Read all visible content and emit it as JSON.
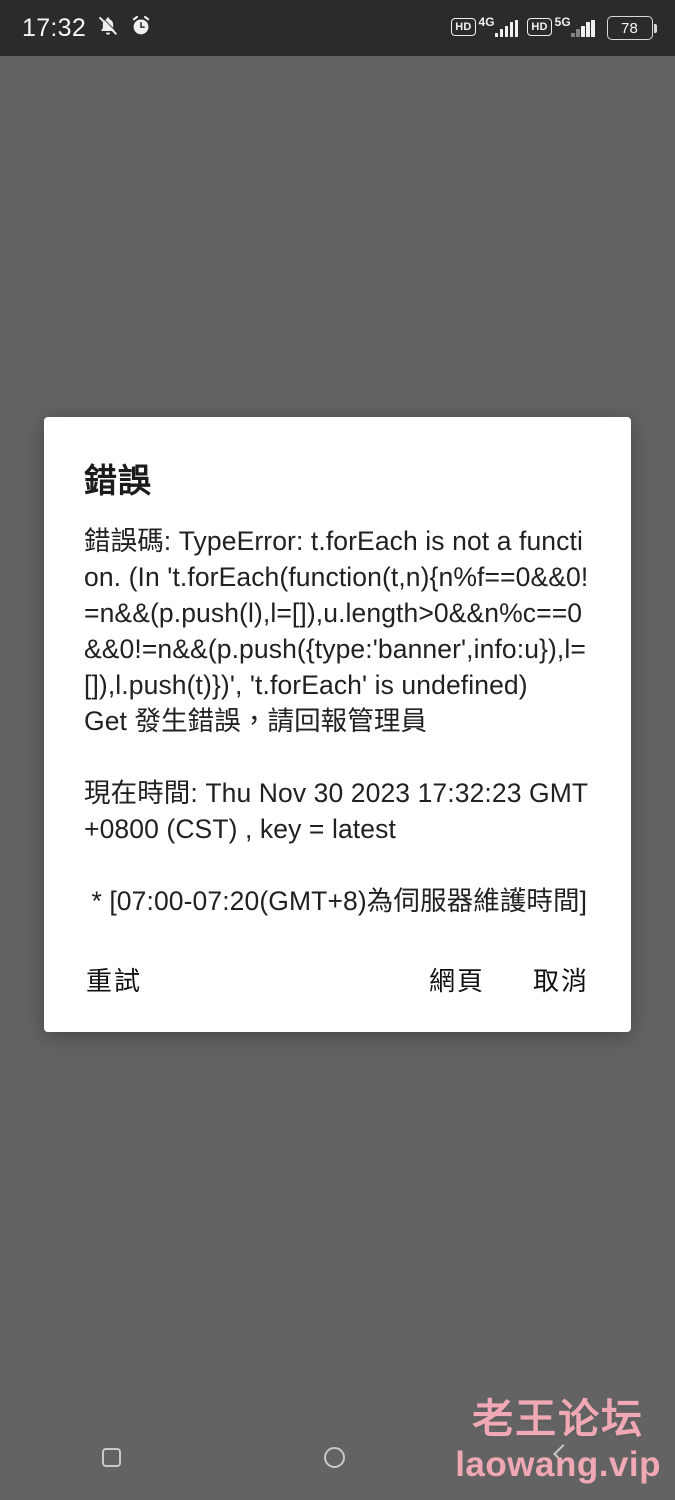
{
  "statusbar": {
    "time": "17:32",
    "icons": {
      "bell": "bell-muted-icon",
      "alarm": "alarm-clock-icon"
    },
    "sim1": {
      "hd": "HD",
      "generation": "4G"
    },
    "sim2": {
      "hd": "HD",
      "generation": "5G"
    },
    "battery": {
      "level": "78"
    }
  },
  "dialog": {
    "title": "錯誤",
    "body": "錯誤碼: TypeError: t.forEach is not a function. (In 't.forEach(function(t,n){n%f==0&&0!=n&&(p.push(l),l=[]),u.length>0&&n%c==0&&0!=n&&(p.push({type:'banner',info:u}),l=[]),l.push(t)})', 't.forEach' is undefined)\nGet 發生錯誤，請回報管理員\n\n現在時間: Thu Nov 30 2023 17:32:23 GMT+0800 (CST) , key = latest\n\n * [07:00-07:20(GMT+8)為伺服器維護時間]",
    "buttons": {
      "retry": "重試",
      "web": "網頁",
      "cancel": "取消"
    }
  },
  "navbar": {
    "recents": "recents-icon",
    "home": "home-icon",
    "back": "back-icon"
  },
  "watermark": {
    "cn": "老王论坛",
    "en": "laowang.vip",
    "color": "#f0a9b4"
  }
}
